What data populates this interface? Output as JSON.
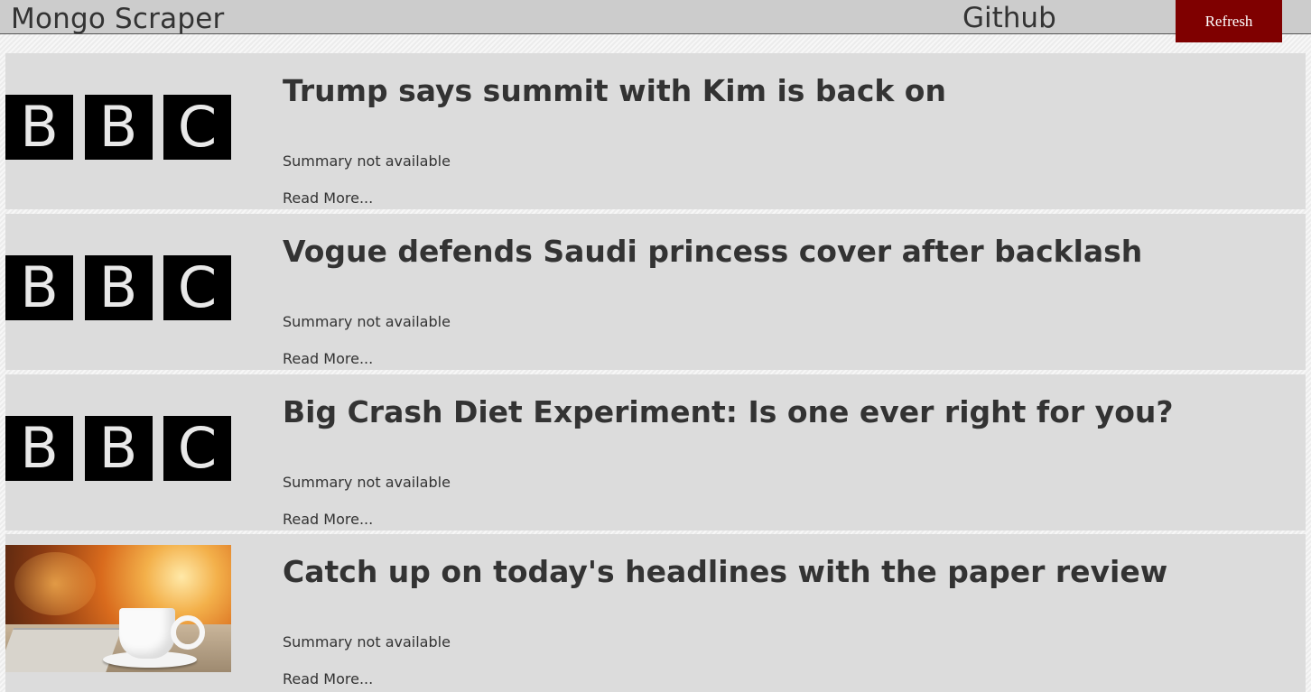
{
  "navbar": {
    "brand": "Mongo Scraper",
    "github_label": "Github",
    "refresh_label": "Refresh",
    "refresh_color": "#7f0000"
  },
  "bbc_logo_letters": [
    "B",
    "B",
    "C"
  ],
  "articles": [
    {
      "image": "bbc-logo",
      "title": "Trump says summit with Kim is back on",
      "summary": "Summary not available",
      "read_more": "Read More..."
    },
    {
      "image": "bbc-logo",
      "title": "Vogue defends Saudi princess cover after backlash",
      "summary": "Summary not available",
      "read_more": "Read More..."
    },
    {
      "image": "bbc-logo",
      "title": "Big Crash Diet Experiment: Is one ever right for you?",
      "summary": "Summary not available",
      "read_more": "Read More..."
    },
    {
      "image": "coffee-newspaper-photo",
      "title": "Catch up on today's headlines with the paper review",
      "summary": "Summary not available",
      "read_more": "Read More..."
    }
  ]
}
